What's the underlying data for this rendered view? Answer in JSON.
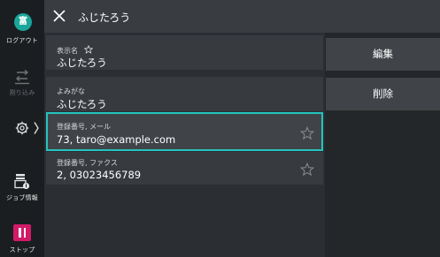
{
  "rail": {
    "logout_glyph": "富",
    "logout_label": "ログアウト",
    "interrupt_label": "割り込み",
    "job_info_label": "ジョブ情報",
    "stop_label": "ストップ"
  },
  "header": {
    "title": "ふじたろう"
  },
  "fields": [
    {
      "label": "表示名",
      "value": "ふじたろう",
      "star": true,
      "star_inline": true
    },
    {
      "label": "よみがな",
      "value": "ふじたろう"
    },
    {
      "label": "登録番号, メール",
      "value": "73, taro@example.com",
      "selected": true
    },
    {
      "label": "登録番号, ファクス",
      "value": "2, 03023456789"
    }
  ],
  "actions": {
    "edit_label": "編集",
    "delete_label": "削除"
  },
  "colors": {
    "accent_teal": "#24c4c0",
    "logout_green": "#1aa69a",
    "stop_magenta": "#d31a67"
  }
}
